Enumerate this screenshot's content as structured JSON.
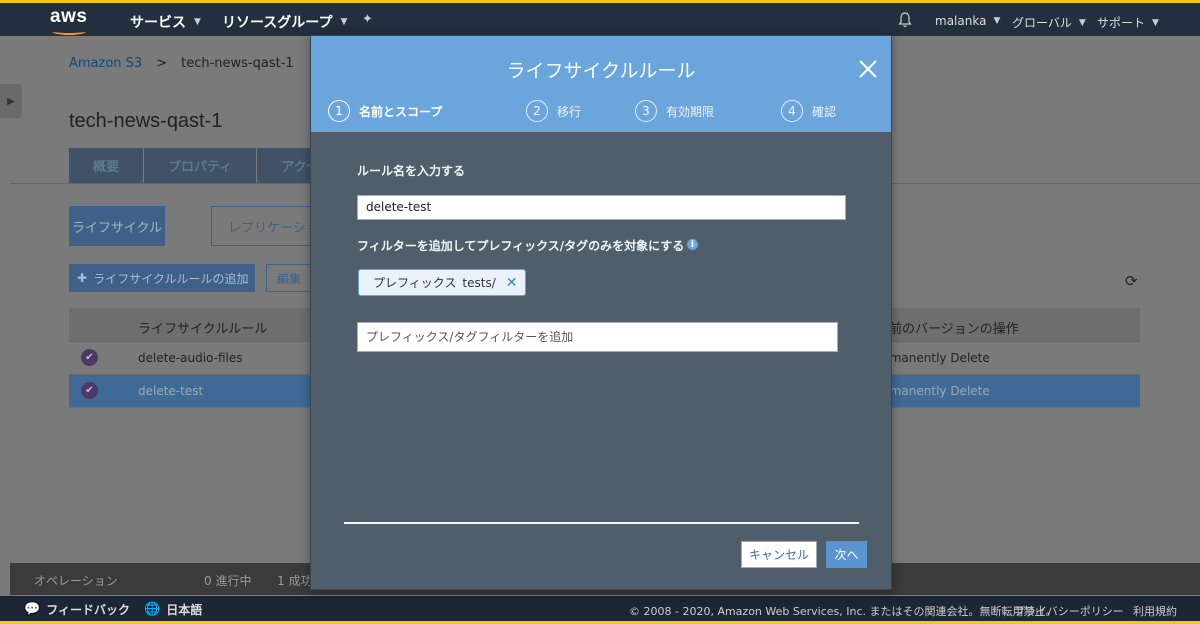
{
  "topnav": {
    "logo": "aws",
    "services": "サービス",
    "resource_groups": "リソースグループ",
    "pin_icon": "pushpin-icon",
    "bell_icon": "bell-icon",
    "user": "malanka",
    "region": "グローバル",
    "support": "サポート"
  },
  "breadcrumb": {
    "root": "Amazon S3",
    "separator": ">",
    "current": "tech-news-qast-1"
  },
  "page_title": "tech-news-qast-1",
  "tabs": [
    "概要",
    "プロパティ",
    "アクセ"
  ],
  "subtabs": {
    "lifecycle": "ライフサイクル",
    "replication": "レプリケーショ"
  },
  "actions": {
    "add": "ライフサイクルルールの追加",
    "edit": "編集"
  },
  "table": {
    "headers": {
      "rule": "ライフサイクルルール",
      "noncurrent": "前のバージョンの操作"
    },
    "rows": [
      {
        "name": "delete-audio-files",
        "action": "rmanently Delete",
        "selected": false
      },
      {
        "name": "delete-test",
        "action": "rmanently Delete",
        "selected": true
      }
    ]
  },
  "status_bar": {
    "label": "オペレーション",
    "in_progress": "0 進行中",
    "success": "1 成功"
  },
  "footer": {
    "feedback": "フィードバック",
    "language": "日本語",
    "copyright": "© 2008 - 2020, Amazon Web Services, Inc. またはその関連会社。無断転用禁止。",
    "privacy": "プライバシーポリシー",
    "terms": "利用規約"
  },
  "modal": {
    "title": "ライフサイクルルール",
    "steps": [
      {
        "num": "1",
        "label": "名前とスコープ",
        "active": true
      },
      {
        "num": "2",
        "label": "移行",
        "active": false
      },
      {
        "num": "3",
        "label": "有効期限",
        "active": false
      },
      {
        "num": "4",
        "label": "確認",
        "active": false
      }
    ],
    "rule_name_label": "ルール名を入力する",
    "rule_name_value": "delete-test",
    "filter_label": "フィルターを追加してプレフィックス/タグのみを対象にする",
    "tag": {
      "key": "プレフィックス",
      "value": "tests/"
    },
    "filter_placeholder": "プレフィックス/タグフィルターを追加",
    "cancel": "キャンセル",
    "next": "次へ"
  },
  "colors": {
    "header_blue": "#6aa5dc",
    "nav_dark": "#232f3e",
    "accent_yellow": "#f2c811",
    "modal_body": "#4f5e6a"
  }
}
